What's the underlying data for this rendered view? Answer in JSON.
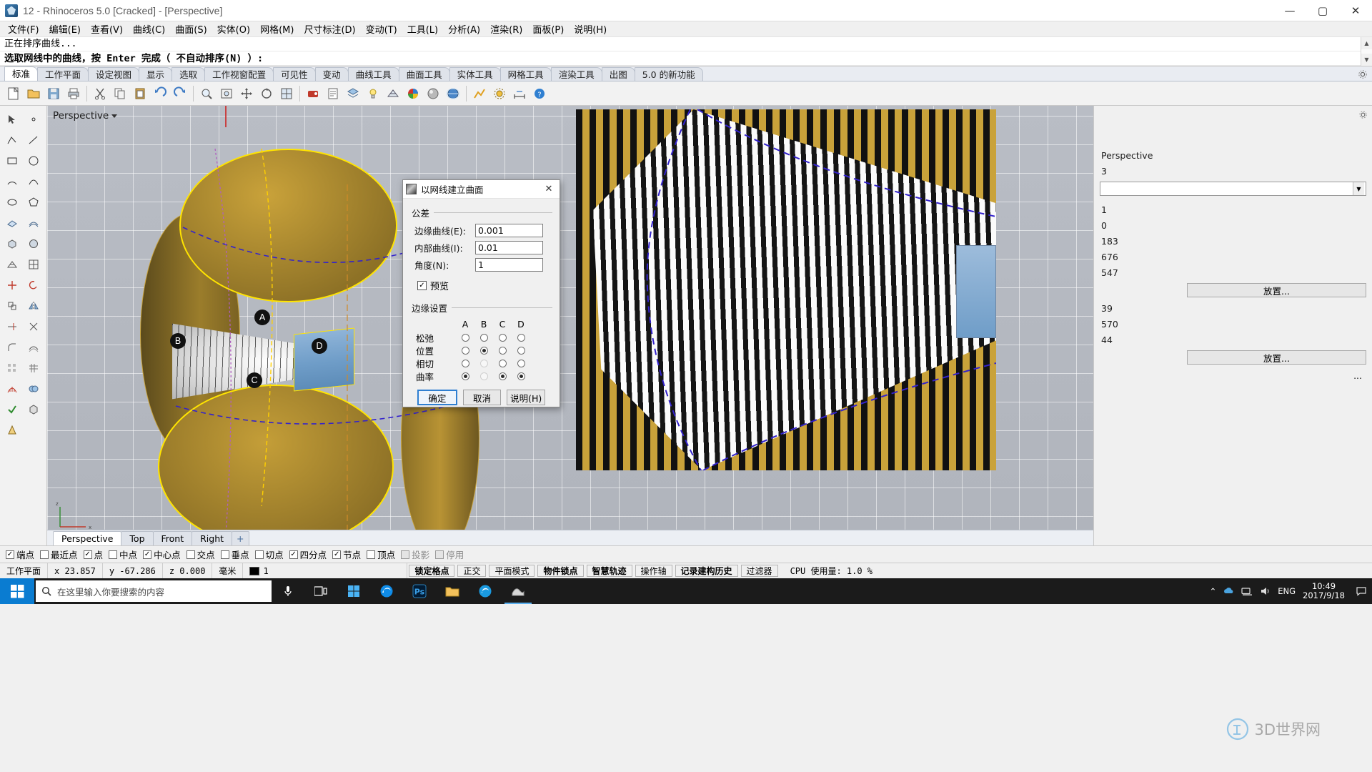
{
  "window": {
    "title": "12 - Rhinoceros 5.0 [Cracked] - [Perspective]",
    "minimize": "—",
    "maximize": "▢",
    "close": "✕"
  },
  "menubar": [
    {
      "label": "文件(F)"
    },
    {
      "label": "编辑(E)"
    },
    {
      "label": "查看(V)"
    },
    {
      "label": "曲线(C)"
    },
    {
      "label": "曲面(S)"
    },
    {
      "label": "实体(O)"
    },
    {
      "label": "网格(M)"
    },
    {
      "label": "尺寸标注(D)"
    },
    {
      "label": "变动(T)"
    },
    {
      "label": "工具(L)"
    },
    {
      "label": "分析(A)"
    },
    {
      "label": "渲染(R)"
    },
    {
      "label": "面板(P)"
    },
    {
      "label": "说明(H)"
    }
  ],
  "command": {
    "history_line": "正在排序曲线...",
    "prompt_line": "选取网线中的曲线，按 Enter 完成（ 不自动排序(N) ）:"
  },
  "toolbar_tabs": [
    {
      "label": "标准",
      "active": true
    },
    {
      "label": "工作平面",
      "active": false
    },
    {
      "label": "设定视图",
      "active": false
    },
    {
      "label": "显示",
      "active": false
    },
    {
      "label": "选取",
      "active": false
    },
    {
      "label": "工作视窗配置",
      "active": false
    },
    {
      "label": "可见性",
      "active": false
    },
    {
      "label": "变动",
      "active": false
    },
    {
      "label": "曲线工具",
      "active": false
    },
    {
      "label": "曲面工具",
      "active": false
    },
    {
      "label": "实体工具",
      "active": false
    },
    {
      "label": "网格工具",
      "active": false
    },
    {
      "label": "渲染工具",
      "active": false
    },
    {
      "label": "出图",
      "active": false
    },
    {
      "label": "5.0 的新功能",
      "active": false
    }
  ],
  "viewport": {
    "label": "Perspective",
    "curve_markers": [
      "A",
      "B",
      "C",
      "D"
    ],
    "tabs": [
      {
        "label": "Perspective",
        "active": true
      },
      {
        "label": "Top",
        "active": false
      },
      {
        "label": "Front",
        "active": false
      },
      {
        "label": "Right",
        "active": false
      },
      {
        "label": "+",
        "active": false
      }
    ]
  },
  "right_panel": {
    "header": "Perspective",
    "value_0": "3",
    "value_1": "1",
    "value_2": "0",
    "value_3": "183",
    "value_4": "676",
    "value_5": "547",
    "place_button_1": "放置...",
    "value_6": "39",
    "value_7": "570",
    "value_8": "44",
    "place_button_2": "放置..."
  },
  "dialog": {
    "title": "以网线建立曲面",
    "close": "✕",
    "tolerance_group": "公差",
    "fields": [
      {
        "label": "边缘曲线(E):",
        "value": "0.001",
        "name": "edge-curve-tolerance"
      },
      {
        "label": "内部曲线(I):",
        "value": "0.01",
        "name": "interior-curve-tolerance"
      },
      {
        "label": "角度(N):",
        "value": "1",
        "name": "angle-tolerance"
      }
    ],
    "preview_label": "预览",
    "preview_checked": true,
    "edge_group": "边缘设置",
    "columns": [
      "A",
      "B",
      "C",
      "D"
    ],
    "rows": [
      {
        "label": "松弛",
        "states": [
          "off",
          "off",
          "off",
          "off"
        ]
      },
      {
        "label": "位置",
        "states": [
          "off",
          "on",
          "off",
          "off"
        ]
      },
      {
        "label": "相切",
        "states": [
          "off",
          "blank",
          "off",
          "off"
        ]
      },
      {
        "label": "曲率",
        "states": [
          "on",
          "blank",
          "on",
          "on"
        ]
      }
    ],
    "buttons": {
      "ok": "确定",
      "cancel": "取消",
      "help": "说明(H)"
    }
  },
  "osnap": [
    {
      "label": "端点",
      "checked": true,
      "disabled": false
    },
    {
      "label": "最近点",
      "checked": false,
      "disabled": false
    },
    {
      "label": "点",
      "checked": true,
      "disabled": false
    },
    {
      "label": "中点",
      "checked": false,
      "disabled": false
    },
    {
      "label": "中心点",
      "checked": true,
      "disabled": false
    },
    {
      "label": "交点",
      "checked": false,
      "disabled": false
    },
    {
      "label": "垂点",
      "checked": false,
      "disabled": false
    },
    {
      "label": "切点",
      "checked": false,
      "disabled": false
    },
    {
      "label": "四分点",
      "checked": true,
      "disabled": false
    },
    {
      "label": "节点",
      "checked": true,
      "disabled": false
    },
    {
      "label": "顶点",
      "checked": false,
      "disabled": false
    },
    {
      "label": "投影",
      "checked": false,
      "disabled": true
    },
    {
      "label": "停用",
      "checked": false,
      "disabled": true
    }
  ],
  "statusbar": {
    "cplane": "工作平面",
    "x": "x 23.857",
    "y": "y -67.286",
    "z": "z 0.000",
    "units": "毫米",
    "layer": "1",
    "toggles": [
      {
        "label": "锁定格点",
        "bold": true
      },
      {
        "label": "正交",
        "bold": false
      },
      {
        "label": "平面模式",
        "bold": false
      },
      {
        "label": "物件锁点",
        "bold": true
      },
      {
        "label": "智慧轨迹",
        "bold": true
      },
      {
        "label": "操作轴",
        "bold": false
      },
      {
        "label": "记录建构历史",
        "bold": true
      },
      {
        "label": "过滤器",
        "bold": false
      }
    ],
    "cpu": "CPU 使用量: 1.0 %"
  },
  "watermark": "3D世界网",
  "taskbar": {
    "search_placeholder": "在这里输入你要搜索的内容",
    "lang": "ENG",
    "time": "10:49",
    "date": "2017/9/18",
    "apps": [
      {
        "name": "task-view-icon"
      },
      {
        "name": "store-icon"
      },
      {
        "name": "edge-icon"
      },
      {
        "name": "photoshop-icon"
      },
      {
        "name": "folder-icon"
      },
      {
        "name": "browser-icon"
      },
      {
        "name": "rhino-icon"
      }
    ]
  }
}
